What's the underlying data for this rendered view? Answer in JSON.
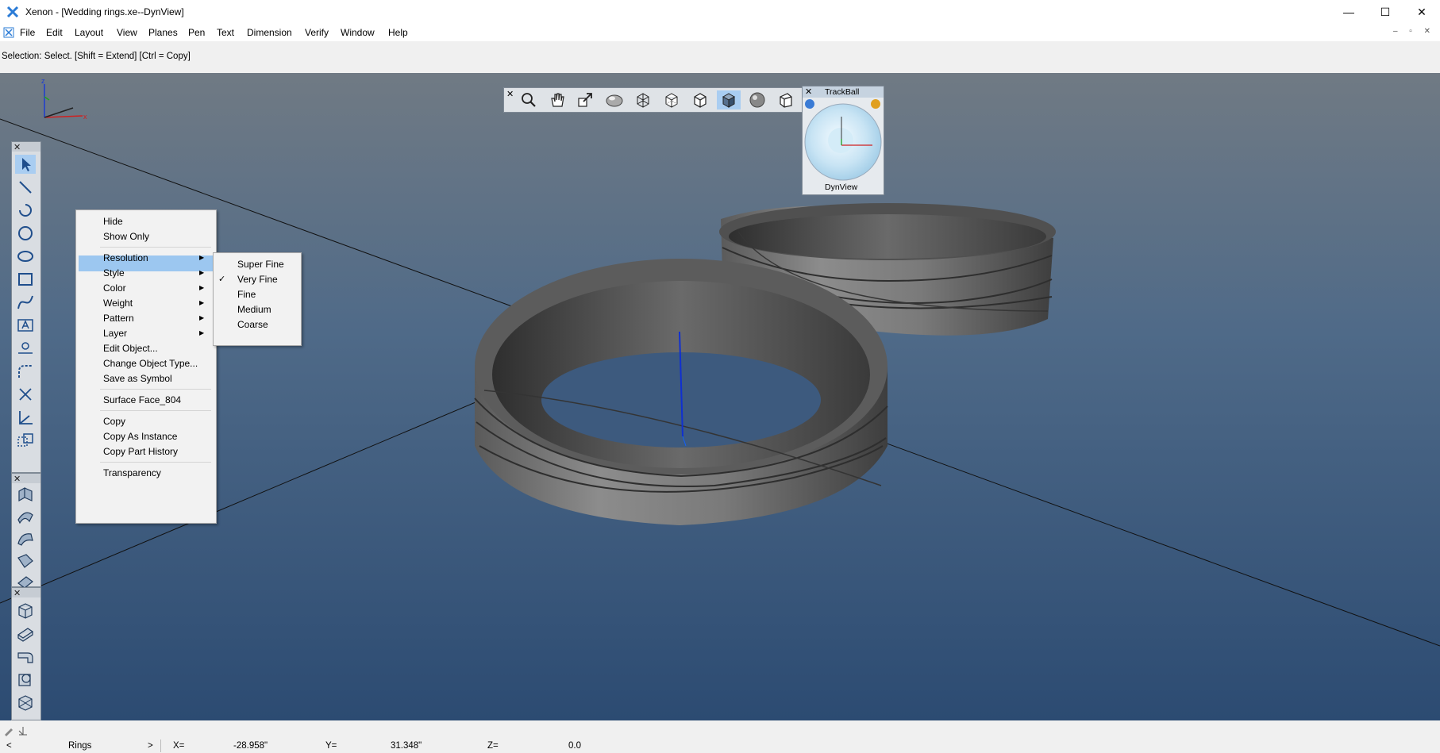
{
  "window": {
    "title": "Xenon - [Wedding rings.xe--DynView]",
    "minimize_glyph": "—",
    "maximize_glyph": "☐",
    "close_glyph": "✕"
  },
  "menu": [
    "File",
    "Edit",
    "Layout",
    "View",
    "Planes",
    "Pen",
    "Text",
    "Dimension",
    "Verify",
    "Window",
    "Help"
  ],
  "status": "Selection: Select. [Shift = Extend] [Ctrl = Copy]",
  "axes": {
    "z": "z",
    "x": "x"
  },
  "view_toolbar": {
    "close": "✕",
    "tools": [
      "zoom-icon",
      "pan-hand-icon",
      "zoom-extents-icon",
      "render-sphere-icon",
      "wireframe-cube-icon",
      "hidden-line-cube-icon",
      "outline-cube-icon",
      "shaded-cube-icon",
      "shaded-sphere-icon",
      "box-view-icon"
    ],
    "active_tool": "shaded-cube-icon"
  },
  "trackball": {
    "title": "TrackBall",
    "label": "DynView",
    "close": "✕"
  },
  "left_toolbars": {
    "close": "✕",
    "drawing": [
      "select-arrow-icon",
      "line-icon",
      "arc-icon",
      "circle-icon",
      "ellipse-icon",
      "rectangle-icon",
      "spline-icon",
      "text-box-icon",
      "dimension-icon",
      "fillet-icon",
      "trim-icon",
      "axes-icon",
      "transform-icon"
    ],
    "surfaces": [
      "extrude-surface-icon",
      "revolve-surface-icon",
      "sweep-surface-icon",
      "loft-surface-icon",
      "blend-surface-icon"
    ],
    "solids": [
      "box-solid-icon",
      "slab-solid-icon",
      "bend-solid-icon",
      "shell-solid-icon",
      "boolean-solid-icon"
    ]
  },
  "context_menu": {
    "items": [
      {
        "label": "Hide",
        "submenu": false
      },
      {
        "label": "Show Only",
        "submenu": false
      },
      {
        "label": "Resolution",
        "submenu": true,
        "highlighted": true
      },
      {
        "label": "Style",
        "submenu": true
      },
      {
        "label": "Color",
        "submenu": true
      },
      {
        "label": "Weight",
        "submenu": true
      },
      {
        "label": "Pattern",
        "submenu": true
      },
      {
        "label": "Layer",
        "submenu": true
      },
      {
        "label": "Edit Object...",
        "submenu": false
      },
      {
        "label": "Change Object Type...",
        "submenu": false
      },
      {
        "label": "Save as Symbol",
        "submenu": false
      },
      {
        "label": "Surface Face_804",
        "submenu": false
      },
      {
        "label": "Copy",
        "submenu": false
      },
      {
        "label": "Copy As Instance",
        "submenu": false
      },
      {
        "label": "Copy Part History",
        "submenu": false
      },
      {
        "label": "Transparency",
        "submenu": false
      }
    ],
    "submenu_arrow": "▶"
  },
  "resolution_submenu": {
    "items": [
      "Super Fine",
      "Very Fine",
      "Fine",
      "Medium",
      "Coarse"
    ],
    "checked": "Very Fine",
    "check_glyph": "✓"
  },
  "bottom_bar": {
    "layer": "Rings",
    "layer_arrow": ">",
    "x_label": "X=",
    "x_value": "-28.958\"",
    "y_label": "Y=",
    "y_value": "31.348\"",
    "z_label": "Z=",
    "z_value": "0.0"
  }
}
